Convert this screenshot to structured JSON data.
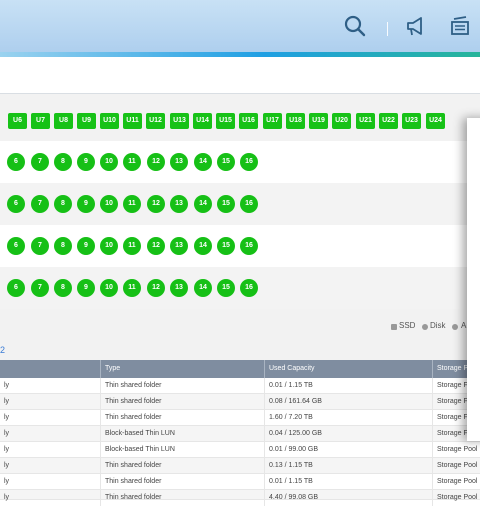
{
  "header": {
    "icons": [
      "search-icon",
      "announcement-icon",
      "notes-icon"
    ],
    "brand_color": "#aecfee"
  },
  "enclosure": {
    "slots": [
      "U6",
      "U7",
      "U8",
      "U9",
      "U10",
      "U11",
      "U12",
      "U13",
      "U14",
      "U15",
      "U16",
      "U17",
      "U18",
      "U19",
      "U20",
      "U21",
      "U22",
      "U23",
      "U24"
    ],
    "status_color": "#16c016",
    "rows": [
      {
        "disks": [
          "6",
          "7",
          "8",
          "9",
          "10",
          "11",
          "12",
          "13",
          "14",
          "15",
          "16"
        ]
      },
      {
        "disks": [
          "6",
          "7",
          "8",
          "9",
          "10",
          "11",
          "12",
          "13",
          "14",
          "15",
          "16"
        ]
      },
      {
        "disks": [
          "6",
          "7",
          "8",
          "9",
          "10",
          "11",
          "12",
          "13",
          "14",
          "15",
          "16"
        ]
      },
      {
        "disks": [
          "6",
          "7",
          "8",
          "9",
          "10",
          "11",
          "12",
          "13",
          "14",
          "15",
          "16"
        ]
      }
    ]
  },
  "legend": {
    "ssd": "SSD",
    "disk": "Disk",
    "partial": "A"
  },
  "link_partial": "2",
  "table": {
    "columns": [
      "Type",
      "Used Capacity",
      "Storage P"
    ],
    "rows": [
      {
        "first": "ly",
        "type": "Thin shared folder",
        "used": "0.01 / 1.15 TB",
        "pool": "Storage F"
      },
      {
        "first": "ly",
        "type": "Thin shared folder",
        "used": "0.08 / 161.64 GB",
        "pool": "Storage F"
      },
      {
        "first": "ly",
        "type": "Thin shared folder",
        "used": "1.60 / 7.20 TB",
        "pool": "Storage F"
      },
      {
        "first": "ly",
        "type": "Block-based Thin LUN",
        "used": "0.04 / 125.00 GB",
        "pool": "Storage F"
      },
      {
        "first": "ly",
        "type": "Block-based Thin LUN",
        "used": "0.01 / 99.00 GB",
        "pool": "Storage Pool"
      },
      {
        "first": "ly",
        "type": "Thin shared folder",
        "used": "0.13 / 1.15 TB",
        "pool": "Storage Pool"
      },
      {
        "first": "ly",
        "type": "Thin shared folder",
        "used": "0.01 / 1.15 TB",
        "pool": "Storage Pool"
      },
      {
        "first": "ly",
        "type": "Thin shared folder",
        "used": "4.40 / 99.08 GB",
        "pool": "Storage Pool"
      }
    ]
  }
}
